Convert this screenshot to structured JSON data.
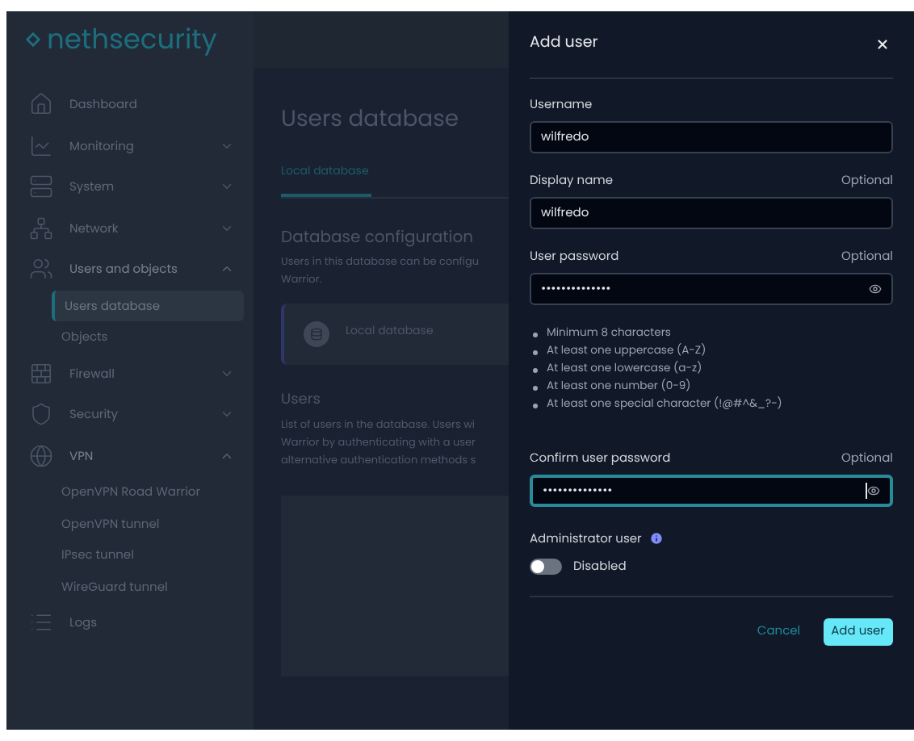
{
  "brand": "nethsecurity",
  "sidebar": {
    "items": [
      {
        "label": "Dashboard"
      },
      {
        "label": "Monitoring",
        "expanded": false
      },
      {
        "label": "System",
        "expanded": false
      },
      {
        "label": "Network",
        "expanded": false
      },
      {
        "label": "Users and objects",
        "expanded": true,
        "children": [
          {
            "label": "Users database",
            "selected": true
          },
          {
            "label": "Objects",
            "selected": false
          }
        ]
      },
      {
        "label": "Firewall",
        "expanded": false
      },
      {
        "label": "Security",
        "expanded": false
      },
      {
        "label": "VPN",
        "expanded": true,
        "children": [
          {
            "label": "OpenVPN Road Warrior",
            "selected": false
          },
          {
            "label": "OpenVPN tunnel",
            "selected": false
          },
          {
            "label": "IPsec tunnel",
            "selected": false
          },
          {
            "label": "WireGuard tunnel",
            "selected": false
          }
        ]
      },
      {
        "label": "Logs"
      }
    ]
  },
  "main": {
    "title": "Users database",
    "tabs": [
      {
        "label": "Local database",
        "selected": true
      }
    ],
    "config_title": "Database configuration",
    "config_text": [
      "Users in this database can be configu",
      "Warrior."
    ],
    "database_card": {
      "label": "Local database"
    },
    "users_title": "Users",
    "users_text": [
      "List of users in the database. Users wi",
      "Warrior by authenticating with a user",
      "alternative authentication methods s"
    ]
  },
  "drawer": {
    "title": "Add user",
    "fields": [
      {
        "label": "Username",
        "value": "wilfredo",
        "password": false,
        "focused": false
      },
      {
        "label": "Display name",
        "optional_text": "Optional",
        "value": "wilfredo",
        "password": false,
        "focused": false
      },
      {
        "label": "User password",
        "optional_text": "Optional",
        "value": "••••••••••••••",
        "password": true,
        "focused": false,
        "hints": [
          "Minimum 8 characters",
          "At least one uppercase (A-Z)",
          "At least one lowercase (a-z)",
          "At least one number (0-9)",
          "At least one special character (!@#^&_?-)"
        ]
      },
      {
        "label": "Confirm user password",
        "optional_text": "Optional",
        "value": "••••••••••••••",
        "password": true,
        "focused": true
      }
    ],
    "admin": {
      "label": "Administrator user",
      "on": false,
      "state_text": "Disabled"
    },
    "buttons": [
      {
        "label": "Cancel",
        "kind": "link"
      },
      {
        "label": "Add user",
        "kind": "primary"
      }
    ]
  }
}
